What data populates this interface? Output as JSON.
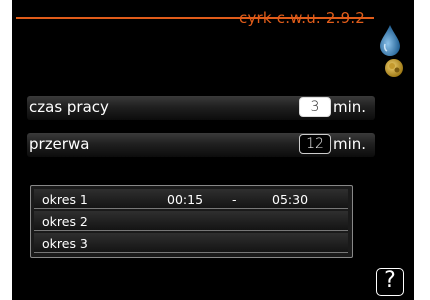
{
  "header": {
    "title": "cyrk c.w.u. 2.9.2"
  },
  "icons": {
    "top": "water-drop-icon",
    "bottom": "sun-mode-icon"
  },
  "settings": [
    {
      "label": "czas pracy",
      "value": "3",
      "unit": "min."
    },
    {
      "label": "przerwa",
      "value": "12",
      "unit": "min."
    }
  ],
  "periods": [
    {
      "label": "okres 1",
      "start": "00:15",
      "separator": "-",
      "end": "05:30"
    },
    {
      "label": "okres 2",
      "start": "",
      "separator": "",
      "end": ""
    },
    {
      "label": "okres 3",
      "start": "",
      "separator": "",
      "end": ""
    }
  ],
  "help": {
    "label": "?"
  },
  "colors": {
    "accent": "#e05c1a",
    "background": "#000000",
    "drop": "#3a7fb8"
  }
}
